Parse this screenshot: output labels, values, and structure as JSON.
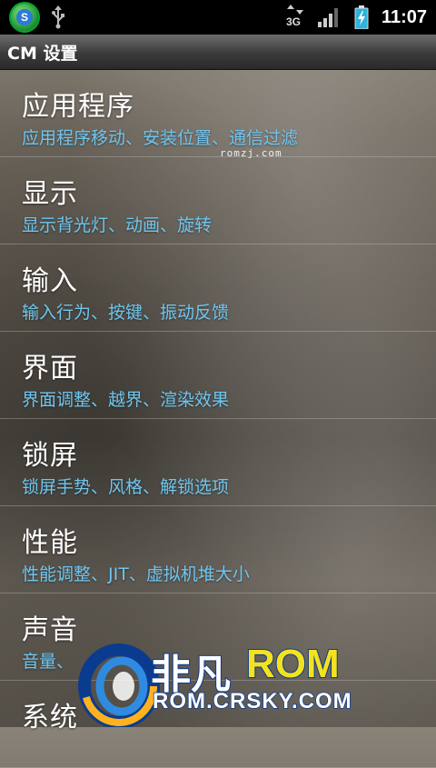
{
  "status_bar": {
    "time": "11:07",
    "network_type": "3G"
  },
  "title_bar": {
    "title": "CM 设置"
  },
  "items": [
    {
      "title": "应用程序",
      "summary": "应用程序移动、安装位置、通信过滤"
    },
    {
      "title": "显示",
      "summary": "显示背光灯、动画、旋转"
    },
    {
      "title": "输入",
      "summary": "输入行为、按键、振动反馈"
    },
    {
      "title": "界面",
      "summary": "界面调整、越界、渲染效果"
    },
    {
      "title": "锁屏",
      "summary": "锁屏手势、风格、解锁选项"
    },
    {
      "title": "性能",
      "summary": "性能调整、JIT、虚拟机堆大小"
    },
    {
      "title": "声音",
      "summary": "音量、"
    },
    {
      "title": "系统",
      "summary": ""
    }
  ],
  "watermark": {
    "small_text": "romzj.com",
    "logo_cn": "非凡",
    "logo_rom": "ROM",
    "logo_url": "ROM.CRSKY.COM"
  },
  "colors": {
    "summary": "#6ec6f0",
    "logo_rom": "#f4e21e",
    "logo_outline": "#0b3b8f"
  }
}
